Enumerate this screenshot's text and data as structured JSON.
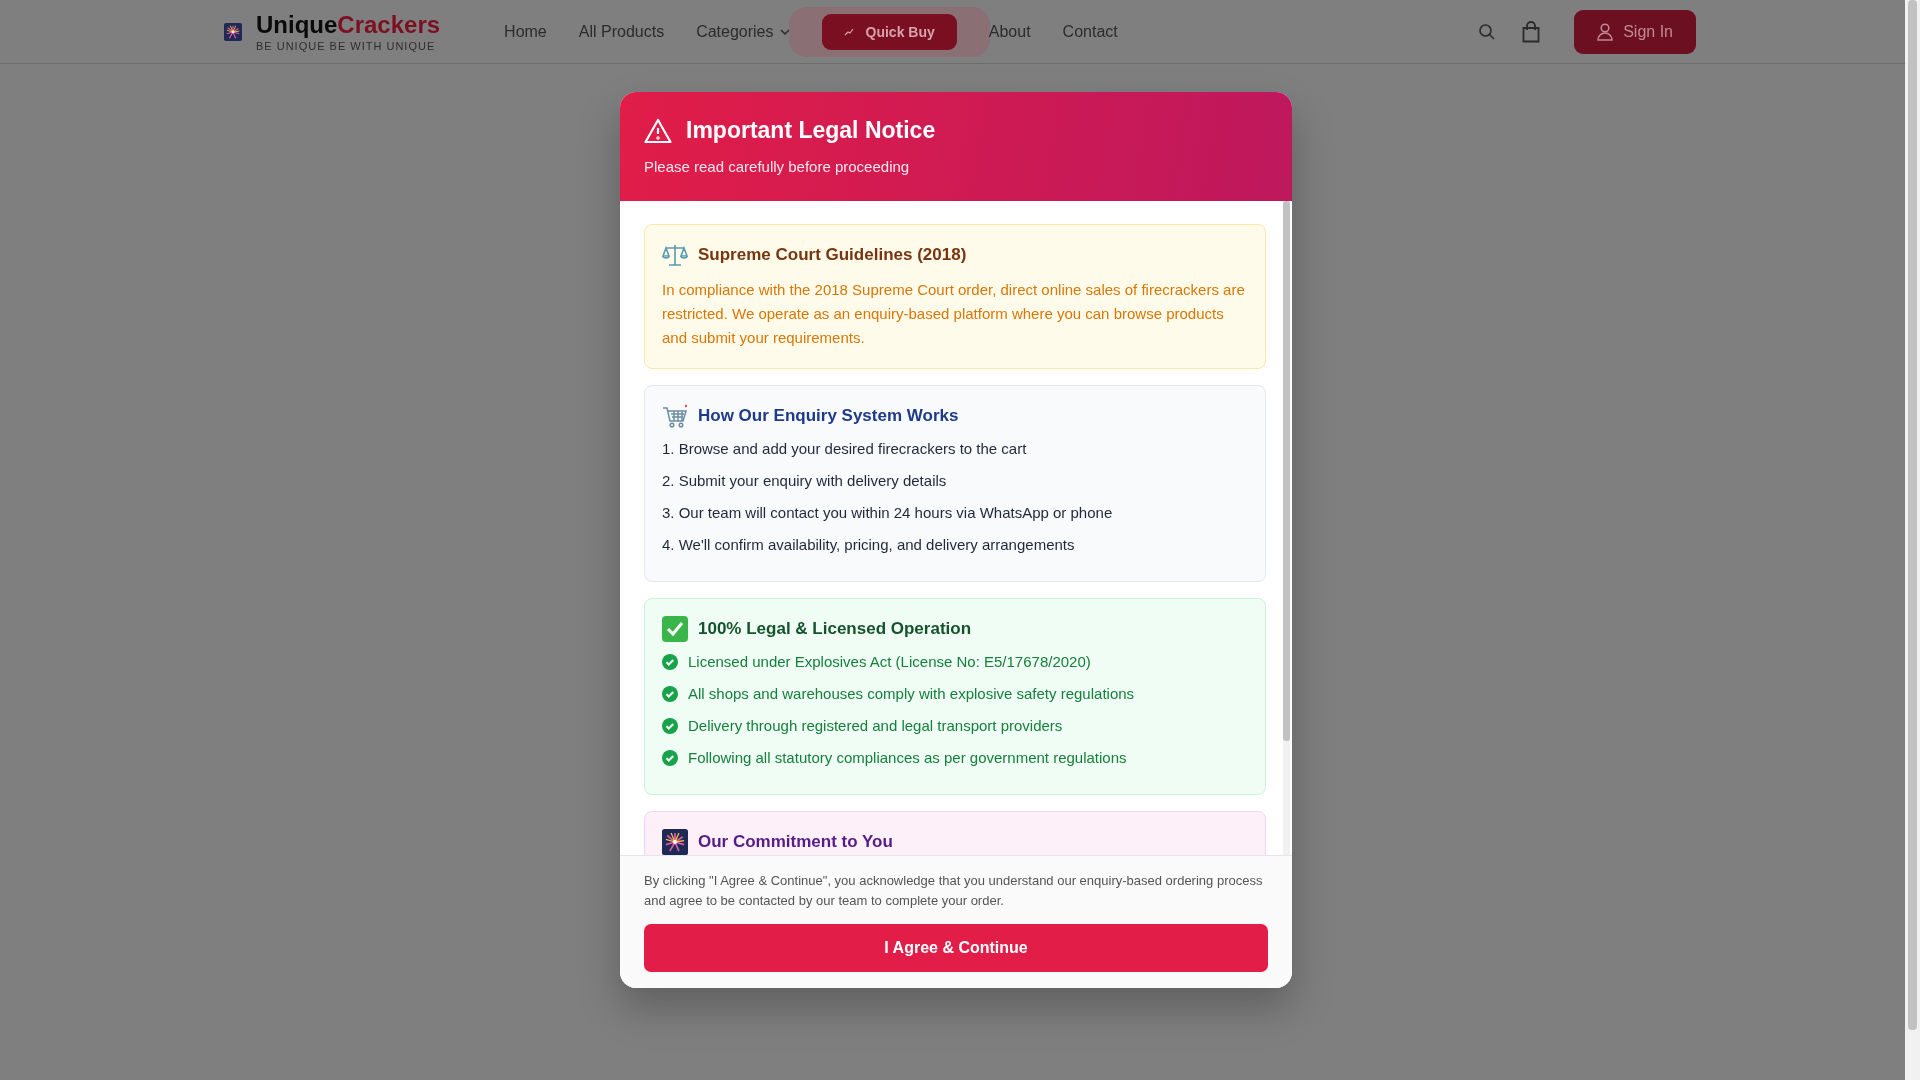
{
  "header": {
    "brand_first": "Unique",
    "brand_second": "Crackers",
    "tagline": "BE UNIQUE BE WITH UNIQUE",
    "nav": [
      {
        "kind": "link",
        "label": "Home"
      },
      {
        "kind": "link",
        "label": "All Products"
      },
      {
        "kind": "dropdown",
        "label": "Categories"
      },
      {
        "kind": "highlight",
        "label": "Quick Buy"
      },
      {
        "kind": "link",
        "label": "About"
      },
      {
        "kind": "link",
        "label": "Contact"
      }
    ],
    "sign_in": "Sign In"
  },
  "notice": {
    "title": "Important Legal Notice",
    "subtitle": "Please read carefully before proceeding",
    "sections": [
      {
        "kind": "warning",
        "title": "Supreme Court Guidelines (2018)",
        "text": "In compliance with the 2018 Supreme Court order, direct online sales of firecrackers are restricted. We operate as an enquiry-based platform where you can browse products and submit your requirements."
      },
      {
        "kind": "steps",
        "title": "How Our Enquiry System Works",
        "items": [
          "1. Browse and add your desired firecrackers to the cart",
          "2. Submit your enquiry with delivery details",
          "3. Our team will contact you within 24 hours via WhatsApp or phone",
          "4. We'll confirm availability, pricing, and delivery arrangements"
        ]
      },
      {
        "kind": "checklist",
        "title": "100% Legal & Licensed Operation",
        "items": [
          "Licensed under Explosives Act (License No: E5/17678/2020)",
          "All shops and warehouses comply with explosive safety regulations",
          "Delivery through registered and legal transport providers",
          "Following all statutory compliances as per government regulations"
        ]
      },
      {
        "kind": "commitment",
        "title": "Our Commitment to You"
      }
    ],
    "footer_note": "By clicking \"I Agree & Continue\", you acknowledge that you understand our enquiry-based ordering process and agree to be contacted by our team to complete your order.",
    "agree_button": "I Agree & Continue"
  }
}
